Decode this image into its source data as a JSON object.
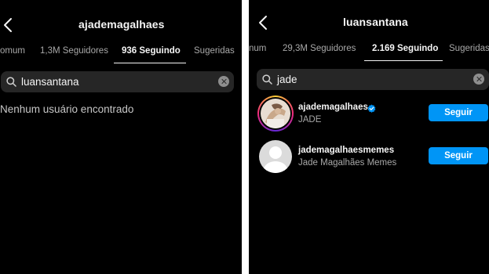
{
  "left": {
    "title": "ajademagalhaes",
    "tabs": [
      "omum",
      "1,3M Seguidores",
      "936 Seguindo",
      "Sugeridas"
    ],
    "search_query": "luansantana",
    "empty_message": "Nenhum usuário encontrado"
  },
  "right": {
    "title": "luansantana",
    "tabs": [
      "num",
      "29,3M Seguidores",
      "2.169 Seguindo",
      "Sugeridas"
    ],
    "search_query": "jade",
    "results": [
      {
        "username": "ajademagalhaes",
        "full_name": "JADE",
        "verified": true,
        "button": "Seguir",
        "avatar_icon": "profile-photo-icon"
      },
      {
        "username": "jademagalhaesmemes",
        "full_name": "Jade Magalhães Memes",
        "verified": false,
        "button": "Seguir",
        "avatar_icon": "default-avatar-icon"
      }
    ]
  },
  "colors": {
    "background": "#000000",
    "accent": "#0095f6",
    "search_field": "#262626",
    "secondary_text": "#a8a8a8"
  }
}
